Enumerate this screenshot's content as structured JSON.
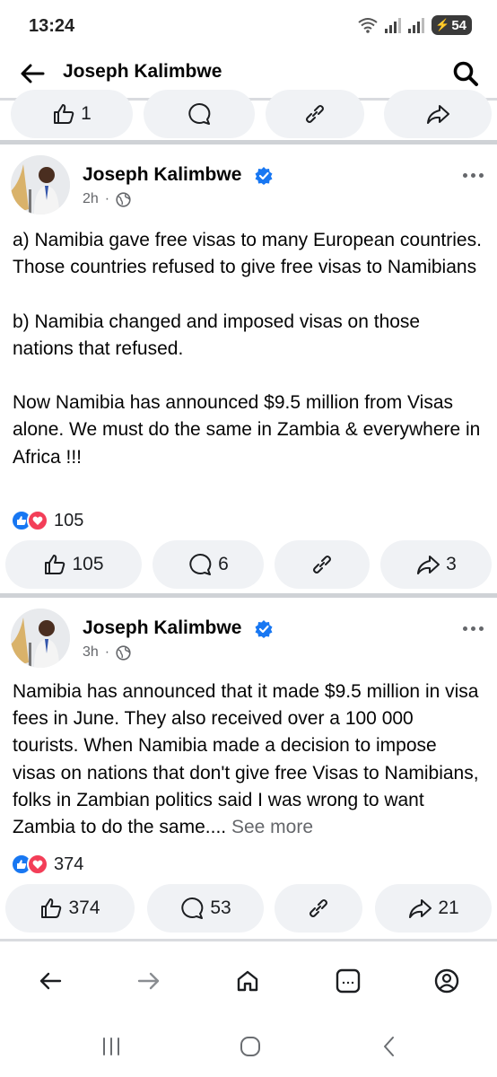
{
  "status_bar": {
    "time": "13:24",
    "battery": "54"
  },
  "app_bar": {
    "title": "Joseph Kalimbwe"
  },
  "top_actions": {
    "like_count": "1"
  },
  "posts": [
    {
      "author": "Joseph Kalimbwe",
      "time": "2h",
      "text": "a) Namibia gave free visas to many European countries. Those countries refused to give free visas to Namibians\n\nb) Namibia changed and imposed visas on those nations that refused.\n\nNow Namibia has announced $9.5 million from Visas alone. We must do the same in Zambia & everywhere in Africa !!!",
      "see_more": "",
      "reaction_count": "105",
      "actions": {
        "likes": "105",
        "comments": "6",
        "shares": "3"
      }
    },
    {
      "author": "Joseph Kalimbwe",
      "time": "3h",
      "text": "Namibia has announced that it made $9.5 million in visa fees in June. They also received over a 100 000 tourists. When Namibia made a decision to impose visas on nations that don't give free Visas to Namibians, folks in Zambian politics said I was wrong to want Zambia to do the same.... ",
      "see_more": "See more",
      "reaction_count": "374",
      "actions": {
        "likes": "374",
        "comments": "53",
        "shares": "21"
      }
    }
  ],
  "colors": {
    "accent": "#1877f2",
    "love": "#f33e58",
    "pill": "#f0f2f5",
    "muted": "#65676b"
  },
  "icons": [
    "back-arrow-icon",
    "search-icon",
    "like-icon",
    "comment-icon",
    "link-icon",
    "share-icon",
    "globe-icon",
    "verified-badge-icon",
    "more-icon",
    "home-icon",
    "bookmark-icon",
    "profile-icon",
    "forward-icon"
  ]
}
